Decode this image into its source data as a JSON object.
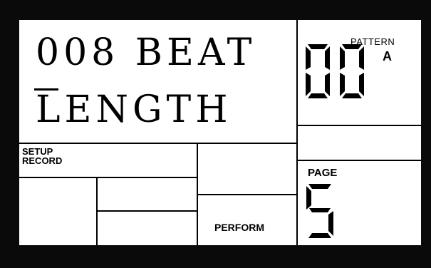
{
  "display": {
    "line1": "008 BEAT",
    "line2": "LENGTH"
  },
  "pattern": {
    "label": "PATTERN",
    "bank": "A",
    "number": "00"
  },
  "modes": {
    "setup": "SETUP",
    "record": "RECORD",
    "perform": "PERFORM"
  },
  "page": {
    "label": "PAGE",
    "number": "5"
  },
  "colors": {
    "bezel": "#0a0a0a",
    "lcd_background": "#ffffff",
    "segment": "#000000"
  }
}
